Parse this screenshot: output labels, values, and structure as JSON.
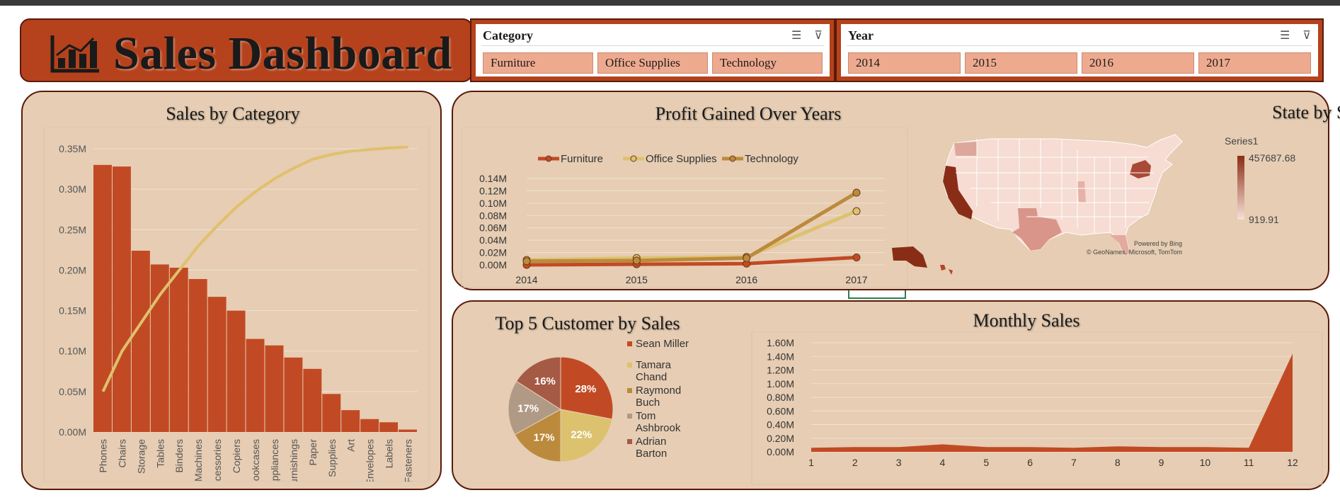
{
  "dashboard": {
    "title": "Sales Dashboard"
  },
  "colors": {
    "brand": "#b5421c",
    "panel_bg": "#e6cdb3",
    "furniture": "#c14a24",
    "office_supplies": "#dcc26e",
    "technology": "#bc8a3c",
    "line_pareto": "#e0c06c"
  },
  "slicers": {
    "category": {
      "title": "Category",
      "options": [
        "Furniture",
        "Office Supplies",
        "Technology"
      ]
    },
    "year": {
      "title": "Year",
      "options": [
        "2014",
        "2015",
        "2016",
        "2017"
      ]
    }
  },
  "map": {
    "title": "State by Sales",
    "legend_title": "Series1",
    "legend_max": "457687.68",
    "legend_min": "919.91",
    "credit_1": "Powered by Bing",
    "credit_2": "© GeoNames, Microsoft, TomTom"
  },
  "chart_data": [
    {
      "type": "bar",
      "title": "Sales by Category",
      "categories": [
        "Phones",
        "Chairs",
        "Storage",
        "Tables",
        "Binders",
        "Machines",
        "Accessories",
        "Copiers",
        "Bookcases",
        "Appliances",
        "Furnishings",
        "Paper",
        "Supplies",
        "Art",
        "Envelopes",
        "Labels",
        "Fasteners"
      ],
      "series": [
        {
          "type": "bar",
          "values": [
            0.33,
            0.328,
            0.224,
            0.207,
            0.203,
            0.189,
            0.167,
            0.15,
            0.115,
            0.107,
            0.092,
            0.078,
            0.047,
            0.027,
            0.016,
            0.012,
            0.003
          ]
        },
        {
          "type": "line",
          "values": [
            0.05,
            0.1,
            0.135,
            0.17,
            0.2,
            0.23,
            0.255,
            0.278,
            0.297,
            0.313,
            0.326,
            0.337,
            0.343,
            0.347,
            0.349,
            0.351,
            0.352
          ]
        }
      ],
      "ylim": [
        0,
        0.35
      ],
      "yticks": [
        "0.00M",
        "0.05M",
        "0.10M",
        "0.15M",
        "0.20M",
        "0.25M",
        "0.30M",
        "0.35M"
      ],
      "grid": true
    },
    {
      "type": "line",
      "title": "Profit Gained Over Years",
      "categories": [
        "2014",
        "2015",
        "2016",
        "2017"
      ],
      "series": [
        {
          "name": "Furniture",
          "values": [
            0.0,
            0.001,
            0.002,
            0.012
          ]
        },
        {
          "name": "Office Supplies",
          "values": [
            0.008,
            0.011,
            0.013,
            0.087
          ]
        },
        {
          "name": "Technology",
          "values": [
            0.006,
            0.007,
            0.011,
            0.117
          ]
        }
      ],
      "ylim": [
        0,
        0.14
      ],
      "yticks": [
        "0.00M",
        "0.02M",
        "0.04M",
        "0.06M",
        "0.08M",
        "0.10M",
        "0.12M",
        "0.14M"
      ],
      "legend": "top"
    },
    {
      "type": "pie",
      "title": "Top 5 Customer by Sales",
      "labels": [
        "Sean Miller",
        "Tamara Chand",
        "Raymond Buch",
        "Tom Ashbrook",
        "Adrian Barton"
      ],
      "values": [
        28,
        22,
        17,
        17,
        16
      ],
      "data_labels": [
        "28%",
        "22%",
        "17%",
        "17%",
        "16%"
      ],
      "colors": [
        "#c14a24",
        "#dcc26e",
        "#bc8a3c",
        "#b09a86",
        "#a55a45"
      ],
      "legend": "right"
    },
    {
      "type": "area",
      "title": "Monthly Sales",
      "x": [
        1,
        2,
        3,
        4,
        5,
        6,
        7,
        8,
        9,
        10,
        11,
        12
      ],
      "values": [
        0.06,
        0.07,
        0.07,
        0.11,
        0.07,
        0.07,
        0.06,
        0.08,
        0.07,
        0.07,
        0.06,
        1.44
      ],
      "ylim": [
        0,
        1.6
      ],
      "yticks": [
        "0.00M",
        "0.20M",
        "0.40M",
        "0.60M",
        "0.80M",
        "1.00M",
        "1.20M",
        "1.40M",
        "1.60M"
      ]
    }
  ]
}
